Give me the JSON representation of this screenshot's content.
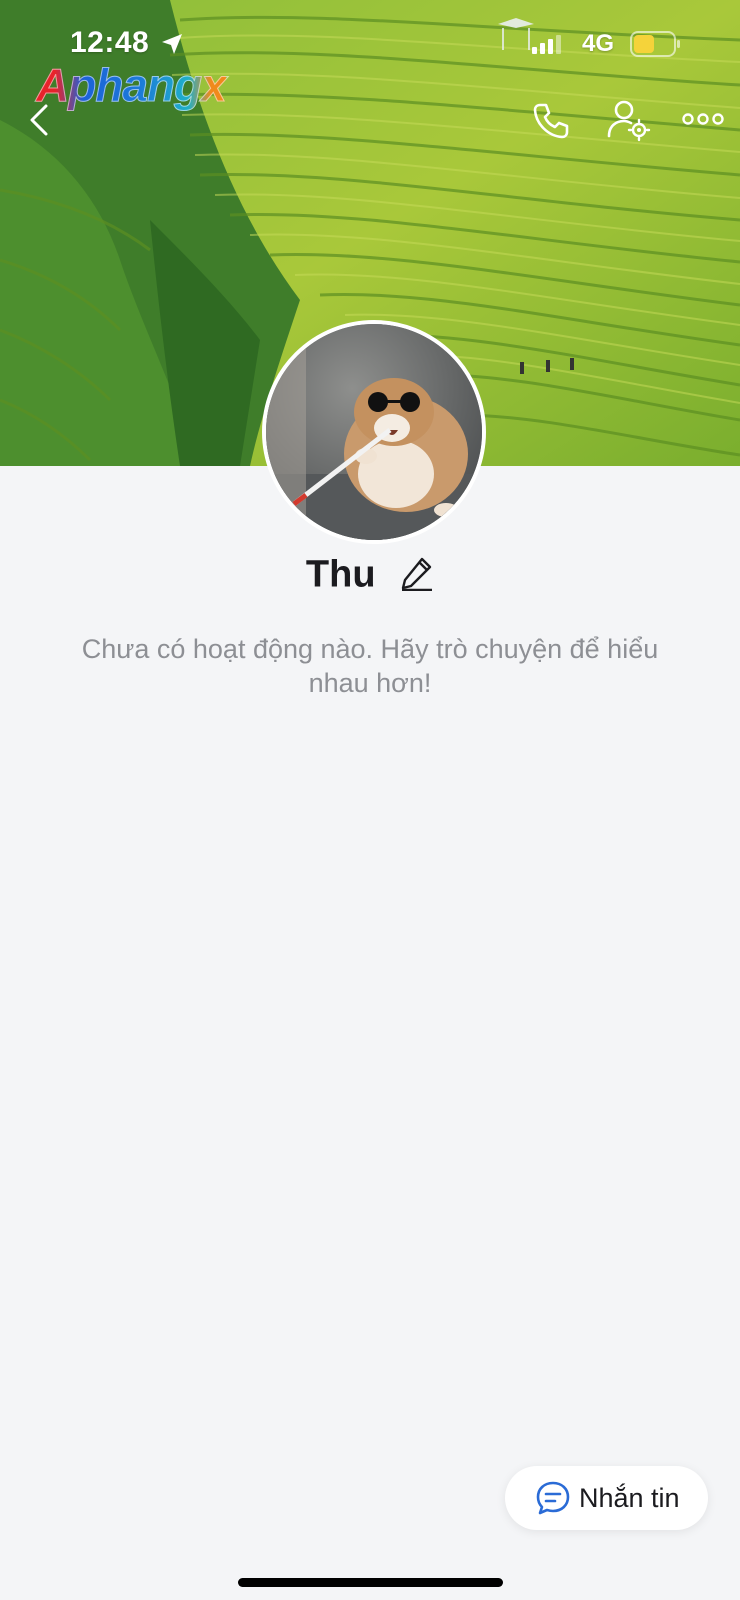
{
  "status_bar": {
    "time": "12:48",
    "network": "4G",
    "icons": [
      "location-arrow-icon",
      "hotspot-icon",
      "signal-icon",
      "battery-icon"
    ],
    "battery_color": "#f5d33a"
  },
  "watermark": "Aphangx",
  "nav": {
    "icons": [
      "back-icon",
      "phone-call-icon",
      "profile-settings-icon",
      "more-icon"
    ]
  },
  "profile": {
    "name": "Thu",
    "edit_icon": "pencil-icon"
  },
  "feed": {
    "empty_message": "Chưa có hoạt động nào. Hãy trò chuyện để hiểu nhau hơn!"
  },
  "actions": {
    "message_label": "Nhắn tin",
    "message_icon": "chat-bubble-icon",
    "accent": "#2a6bd6"
  }
}
